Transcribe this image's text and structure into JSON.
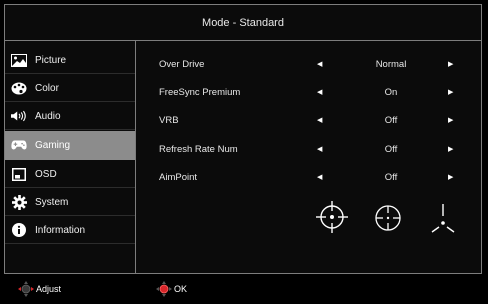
{
  "title": "Mode - Standard",
  "sidebar": {
    "items": [
      {
        "label": "Picture",
        "icon": "picture-icon",
        "active": false
      },
      {
        "label": "Color",
        "icon": "palette-icon",
        "active": false
      },
      {
        "label": "Audio",
        "icon": "speaker-icon",
        "active": false
      },
      {
        "label": "Gaming",
        "icon": "gamepad-icon",
        "active": true
      },
      {
        "label": "OSD",
        "icon": "osd-window-icon",
        "active": false
      },
      {
        "label": "System",
        "icon": "gear-icon",
        "active": false
      },
      {
        "label": "Information",
        "icon": "info-icon",
        "active": false
      }
    ]
  },
  "settings": [
    {
      "label": "Over Drive",
      "value": "Normal"
    },
    {
      "label": "FreeSync Premium",
      "value": "On"
    },
    {
      "label": "VRB",
      "value": "Off"
    },
    {
      "label": "Refresh Rate Num",
      "value": "Off"
    },
    {
      "label": "AimPoint",
      "value": "Off"
    }
  ],
  "aimpoint_options": [
    "crosshair-circle-icon",
    "crosshair-dotted-circle-icon",
    "crosshair-tri-icon"
  ],
  "footer": {
    "adjust_label": "Adjust",
    "ok_label": "OK"
  },
  "colors": {
    "active_bg": "#8c8c8c",
    "border": "#7d7d7d",
    "dpad_red": "#d8262a"
  }
}
